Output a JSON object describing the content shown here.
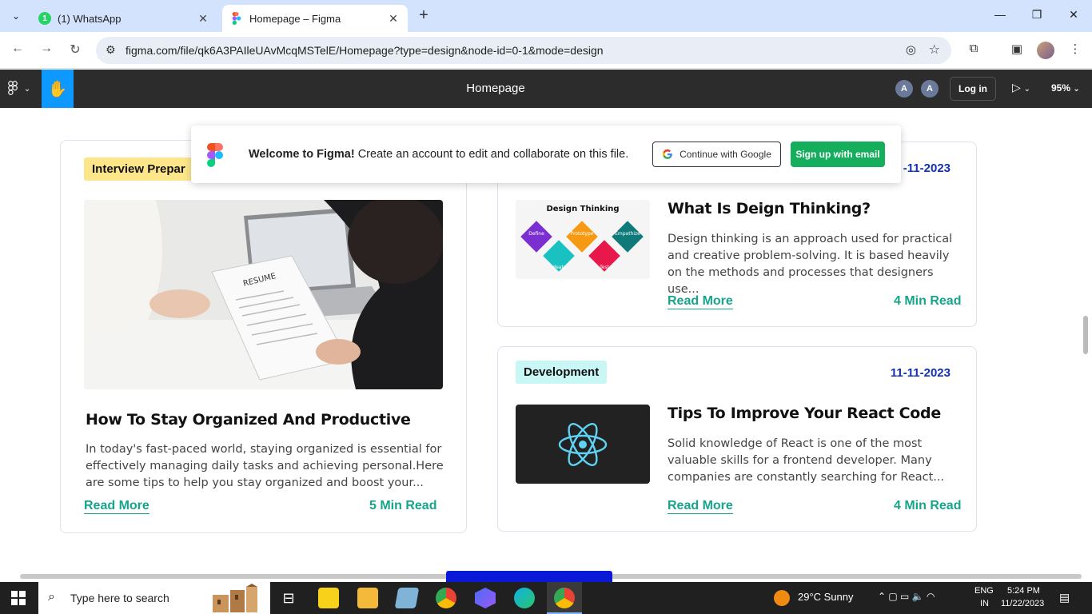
{
  "browser": {
    "tabs": [
      {
        "title": "(1) WhatsApp",
        "badge": "1"
      },
      {
        "title": "Homepage – Figma"
      }
    ],
    "url": "figma.com/file/qk6A3PAIleUAvMcqMSTelE/Homepage?type=design&node-id=0-1&mode=design"
  },
  "figma": {
    "file_title": "Homepage",
    "avatars": [
      "A",
      "A"
    ],
    "login_label": "Log in",
    "zoom": "95%"
  },
  "banner": {
    "bold": "Welcome to Figma!",
    "text": " Create an account to edit and collaborate on this file.",
    "google_label": "Continue with Google",
    "email_label": "Sign up with email"
  },
  "cards": [
    {
      "tag": "Interview Prepar",
      "title": "How To Stay Organized And Productive",
      "desc": "In today's fast-paced world, staying organized is essential for effectively managing daily tasks  and achieving personal.Here are some tips to help you stay organized and boost your...",
      "read_more": "Read More",
      "read_time": "5 Min Read",
      "image": "resume"
    },
    {
      "date": "-11-2023",
      "title": "What Is Deign Thinking?",
      "desc": "Design thinking is an approach used for practical and creative problem-solving. It is based heavily on the methods and processes that designers use...",
      "read_more": "Read More",
      "read_time": "4 Min Read",
      "image_caption": "Design Thinking",
      "image_stages": [
        "Define",
        "Prototype",
        "Empathize",
        "Ideate",
        "Test"
      ]
    },
    {
      "tag": "Development",
      "date": "11-11-2023",
      "title": "Tips To Improve Your React Code",
      "desc": "Solid knowledge of React is one of the most valuable skills for a frontend developer. Many companies are constantly searching for React...",
      "read_more": "Read More",
      "read_time": "4 Min Read",
      "image": "react-logo"
    }
  ],
  "taskbar": {
    "search_placeholder": "Type here to search",
    "weather": "29°C  Sunny",
    "lang": "ENG",
    "region": "IN",
    "time": "5:24 PM",
    "date": "11/22/2023"
  },
  "colors": {
    "accent_green": "#16a58a",
    "date_blue": "#1230b8",
    "figma_blue": "#0d99ff",
    "signup_green": "#14ae5c"
  }
}
